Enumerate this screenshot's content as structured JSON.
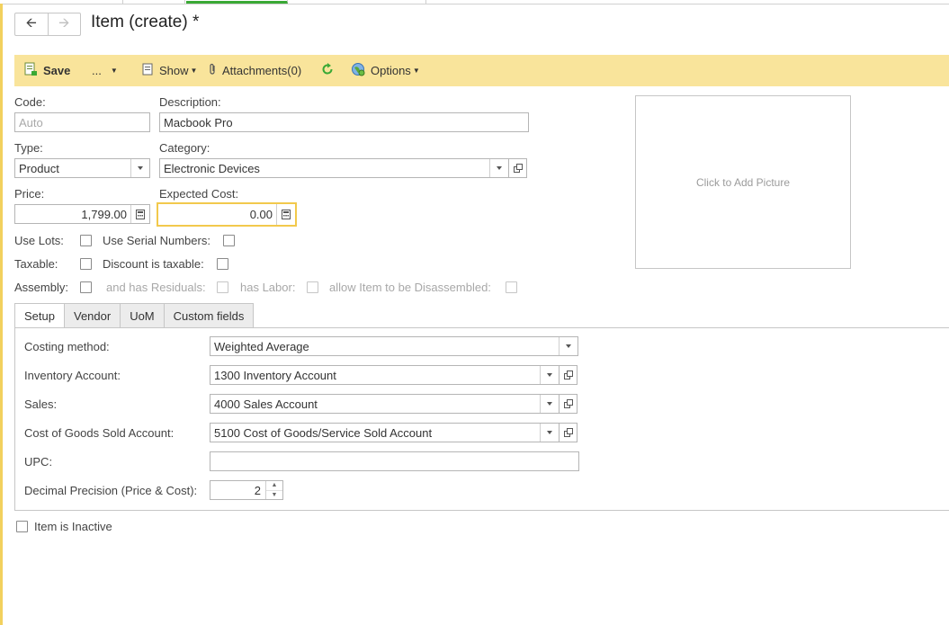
{
  "header": {
    "title": "Item (create) *"
  },
  "toolbar": {
    "save_label": "Save",
    "more_label": "...",
    "show_label": "Show",
    "attachments_label": "Attachments(0)",
    "options_label": "Options"
  },
  "form": {
    "code_label": "Code:",
    "code_placeholder": "Auto",
    "description_label": "Description:",
    "description_value": "Macbook Pro",
    "type_label": "Type:",
    "type_value": "Product",
    "category_label": "Category:",
    "category_value": "Electronic Devices",
    "price_label": "Price:",
    "price_value": "1,799.00",
    "expected_cost_label": "Expected Cost:",
    "expected_cost_value": "0.00",
    "use_lots_label": "Use Lots:",
    "use_serial_label": "Use Serial Numbers:",
    "taxable_label": "Taxable:",
    "discount_taxable_label": "Discount is taxable:",
    "assembly_label": "Assembly:",
    "has_residuals_label": "and has Residuals:",
    "has_labor_label": "has Labor:",
    "allow_disassemble_label": "allow Item to be Disassembled:",
    "picture_label": "Click to Add Picture"
  },
  "tabs": [
    {
      "label": "Setup"
    },
    {
      "label": "Vendor"
    },
    {
      "label": "UoM"
    },
    {
      "label": "Custom fields"
    }
  ],
  "setup": {
    "costing_label": "Costing method:",
    "costing_value": "Weighted Average",
    "inventory_label": "Inventory Account:",
    "inventory_value": "1300 Inventory Account",
    "sales_label": "Sales:",
    "sales_value": "4000 Sales Account",
    "cogs_label": "Cost of Goods Sold Account:",
    "cogs_value": "5100 Cost of Goods/Service Sold Account",
    "upc_label": "UPC:",
    "upc_value": "",
    "precision_label": "Decimal Precision (Price & Cost):",
    "precision_value": "2"
  },
  "footer": {
    "inactive_label": "Item is Inactive"
  },
  "colors": {
    "accent": "#f9e49b",
    "focus_border": "#f2c94c",
    "refresh_green": "#3aa935"
  }
}
